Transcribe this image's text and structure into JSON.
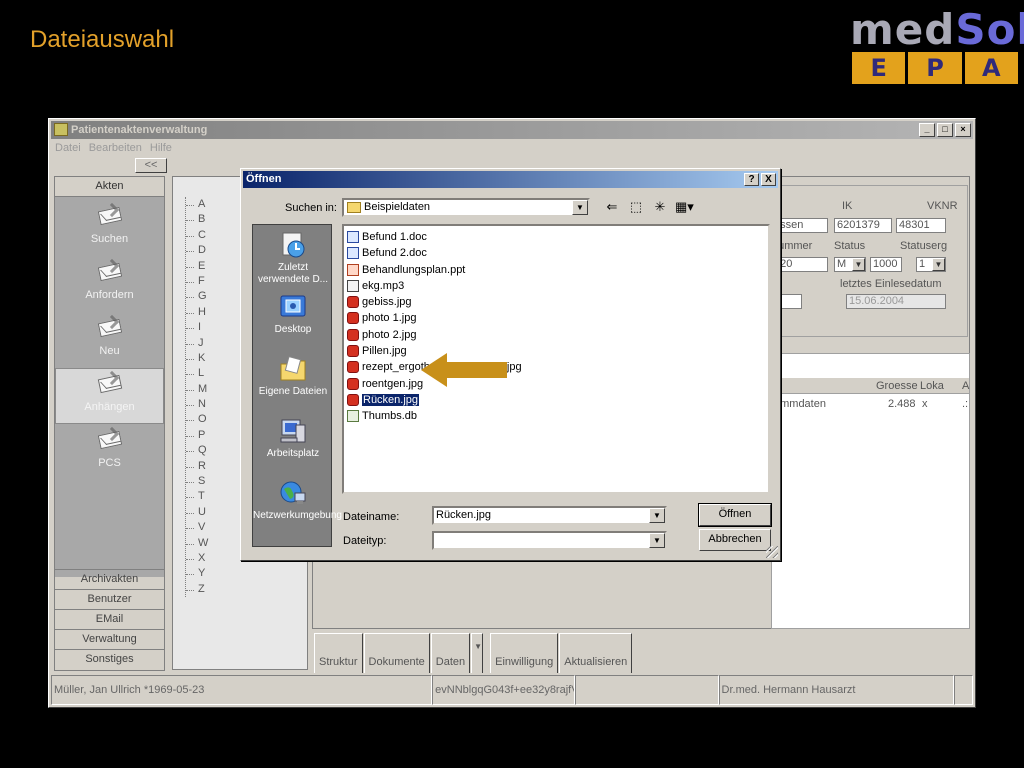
{
  "slide": {
    "title": "Dateiauswahl",
    "logo_med": "med",
    "logo_sol": "Sol",
    "logo_epa": [
      "E",
      "P",
      "A"
    ]
  },
  "app": {
    "title": "Patientenaktenverwaltung",
    "menu": [
      "Datei",
      "Bearbeiten",
      "Hilfe"
    ],
    "collapse_label": "<<",
    "nav_header": "Akten",
    "nav_items": [
      "Suchen",
      "Anfordern",
      "Neu",
      "Anhängen",
      "PCS"
    ],
    "nav_bottom": [
      "Archivakten",
      "Benutzer",
      "EMail",
      "Verwaltung",
      "Sonstiges"
    ],
    "alphabet": [
      "A",
      "B",
      "C",
      "D",
      "E",
      "F",
      "G",
      "H",
      "I",
      "J",
      "K",
      "L",
      "M",
      "N",
      "O",
      "P",
      "Q",
      "R",
      "S",
      "T",
      "U",
      "V",
      "W",
      "X",
      "Y",
      "Z"
    ],
    "details": {
      "ik_label": "IK",
      "vknr_label": "VKNR",
      "name_value": "essen",
      "ik_value": "6201379",
      "vknr_value": "48301",
      "nummer_label": "nummer",
      "status_label": "Status",
      "statuserg_label": "Statuserg",
      "nummer_value": "920",
      "status_value": "M",
      "status2_value": "1000",
      "statuserg_value": "1",
      "s_label": "s",
      "einlese_label": "letztes Einlesedatum",
      "einlese_value": "15.06.2004"
    },
    "table": {
      "col_p": "p",
      "col_groesse": "Groesse",
      "col_lok": "Loka",
      "col_a": "A",
      "row_name": "ammdaten",
      "row_groesse": "2.488",
      "row_lok": "x",
      "row_a": ".:"
    },
    "bottom_tabs": [
      "Struktur",
      "Dokumente",
      "Daten",
      "Einwilligung",
      "Aktualisieren"
    ],
    "status": {
      "patient": "Müller, Jan Ullrich *1969-05-23",
      "hash": "evNNblgqG043f+ee32y8rajfVx",
      "empty": "",
      "doctor": "Dr.med. Hermann Hausarzt"
    }
  },
  "dialog": {
    "title": "Öffnen",
    "help": "?",
    "close": "X",
    "lookin_label": "Suchen in:",
    "lookin_value": "Beispieldaten",
    "places": [
      "Zuletzt verwendete D...",
      "Desktop",
      "Eigene Dateien",
      "Arbeitsplatz",
      "Netzwerkumgebung"
    ],
    "files": [
      {
        "name": "Befund 1.doc",
        "type": "doc"
      },
      {
        "name": "Befund 2.doc",
        "type": "doc"
      },
      {
        "name": "Behandlungsplan.ppt",
        "type": "ppt"
      },
      {
        "name": "ekg.mp3",
        "type": "mp3"
      },
      {
        "name": "gebiss.jpg",
        "type": "jpg"
      },
      {
        "name": "photo 1.jpg",
        "type": "jpg"
      },
      {
        "name": "photo 2.jpg",
        "type": "jpg"
      },
      {
        "name": "Pillen.jpg",
        "type": "jpg"
      },
      {
        "name": "rezept_ergotherapie_beispiel.jpg",
        "type": "jpg"
      },
      {
        "name": "roentgen.jpg",
        "type": "jpg"
      },
      {
        "name": "Rücken.jpg",
        "type": "jpg",
        "selected": true
      },
      {
        "name": "Thumbs.db",
        "type": "db"
      }
    ],
    "filename_label": "Dateiname:",
    "filename_value": "Rücken.jpg",
    "filetype_label": "Dateityp:",
    "filetype_value": "",
    "open_button": "Öffnen",
    "cancel_button": "Abbrechen"
  },
  "colors": {
    "slide_title": "#e3a12a",
    "logo_grey": "#a9a9b6",
    "logo_blue": "#6a6ad8",
    "logo_gold": "#e3a21c",
    "dialog_title": "#0a246a",
    "annotation_arrow": "#c8901a"
  },
  "icons": {
    "recent": "clock-document-icon",
    "desktop": "desktop-icon",
    "documents": "folder-documents-icon",
    "computer": "computer-icon",
    "network": "network-globe-icon"
  }
}
